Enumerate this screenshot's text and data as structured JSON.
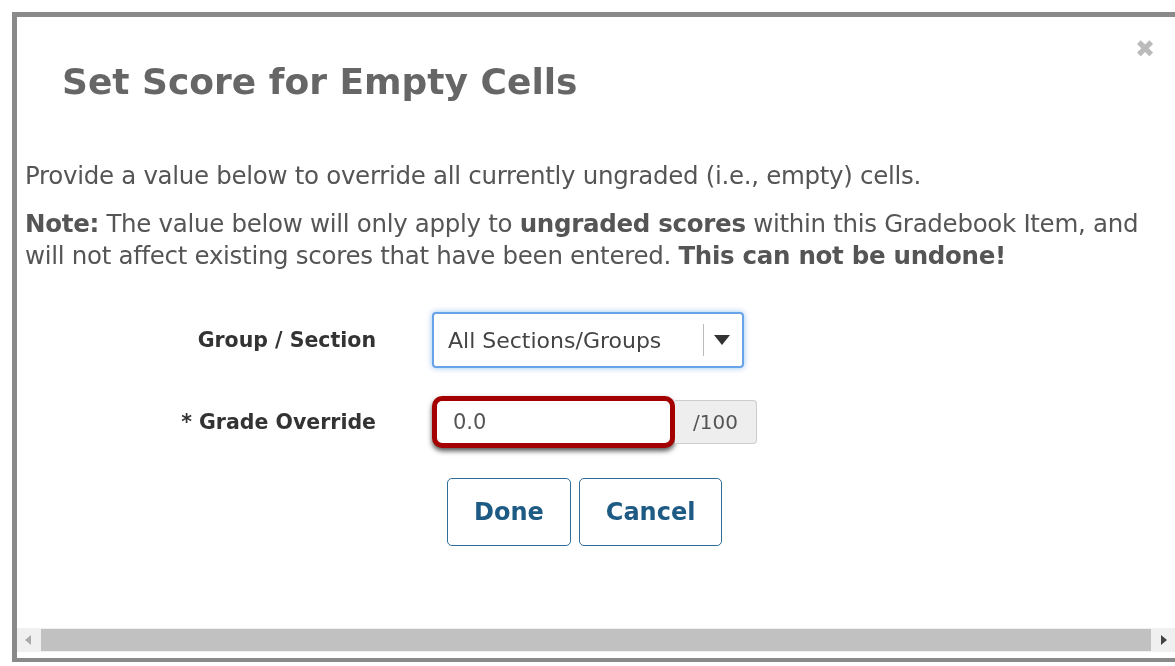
{
  "dialog": {
    "title": "Set Score for Empty Cells",
    "close": "✖",
    "intro": "Provide a value below to override all currently ungraded (i.e., empty) cells.",
    "note": "**Note:** The value below will only apply to **ungraded scores** within this Gradebook Item, and will not affect existing scores that have been entered. **This can not be undone!**",
    "fields": [
      {
        "kind": "select",
        "label": "Group / Section",
        "value": "All Sections/Groups",
        "focused": true,
        "highlighted": false
      },
      {
        "kind": "input",
        "label": "* Grade Override",
        "value": "0.0",
        "addon": "/100",
        "focused": false,
        "highlighted": true
      }
    ],
    "buttons": [
      "Done",
      "Cancel"
    ]
  }
}
